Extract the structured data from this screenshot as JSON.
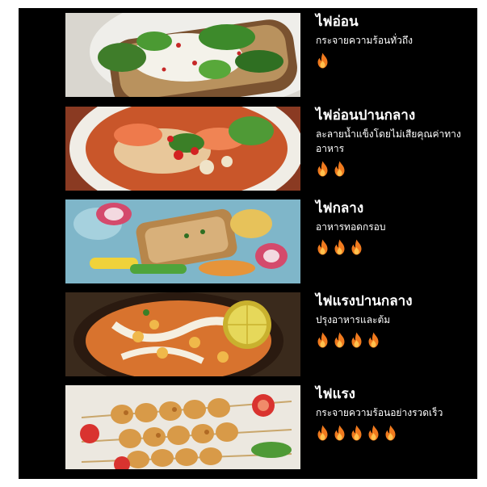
{
  "theme": {
    "flame_color": "#f07a1e",
    "flame_inner": "#ffc14d"
  },
  "levels": [
    {
      "title": "ไฟอ่อน",
      "description": "กระจายความร้อนทั่วถึง",
      "flames": 1,
      "photo": "avocado-toast-photo"
    },
    {
      "title": "ไฟอ่อนปานกลาง",
      "description": "ละลายน้ำแข็งโดยไม่เสียคุณค่าทางอาหาร",
      "flames": 2,
      "photo": "shrimp-noodle-soup-photo"
    },
    {
      "title": "ไฟกลาง",
      "description": "อาหารทอดกรอบ",
      "flames": 3,
      "photo": "grilled-fish-vegetables-photo"
    },
    {
      "title": "ไฟแรงปานกลาง",
      "description": "ปรุงอาหารและต้ม",
      "flames": 4,
      "photo": "curry-pan-lime-photo"
    },
    {
      "title": "ไฟแรง",
      "description": "กระจายความร้อนอย่างรวดเร็ว",
      "flames": 5,
      "photo": "chicken-skewers-photo"
    }
  ]
}
